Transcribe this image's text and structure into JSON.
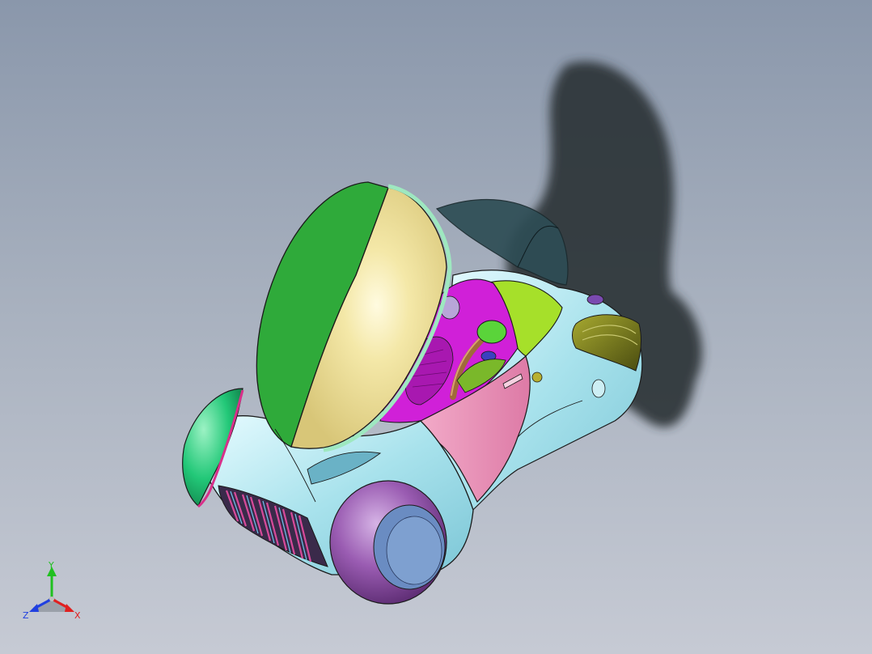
{
  "viewport": {
    "background_top": "#8a97ab",
    "background_bottom": "#c6cad4"
  },
  "model": {
    "colors": {
      "canopy_green": "#2faa3a",
      "canopy_yellow": "#eedd90",
      "body_cyan": "#a8e2ec",
      "body_pink": "#e98cb6",
      "seat_magenta": "#d020d8",
      "rear_panel_lime": "#a6e02a",
      "wheel_purple": "#8a4a9e",
      "hub_blue": "#6a8cc2",
      "rear_olive": "#7a7d1c",
      "front_mint": "#22c878",
      "grille_stripes": "#d84a9a",
      "door_dark": "#2e4d55",
      "shadow": "#2a3034"
    }
  },
  "triad": {
    "x_label": "X",
    "y_label": "Y",
    "z_label": "Z",
    "x_color": "#e02020",
    "y_color": "#20c020",
    "z_color": "#2040e0"
  }
}
